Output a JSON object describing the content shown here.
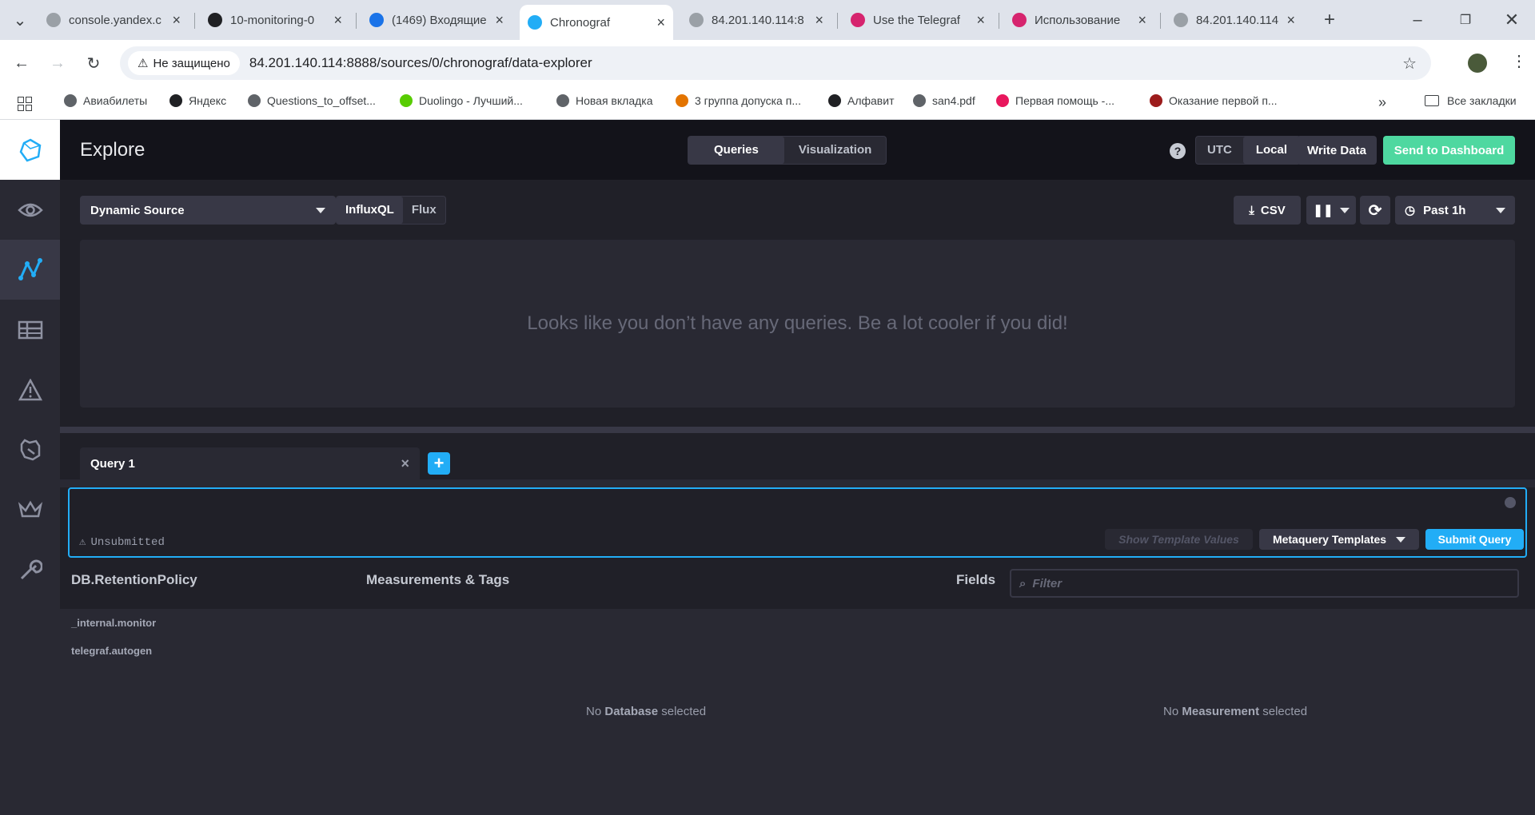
{
  "browser": {
    "tabs": [
      {
        "title": "console.yandex.c",
        "icon": "globe-icon",
        "color": "#9aa0a6"
      },
      {
        "title": "10-monitoring-0",
        "icon": "github-icon",
        "color": "#202124"
      },
      {
        "title": "(1469) Входящие",
        "icon": "mail-icon",
        "color": "#1a73e8"
      },
      {
        "title": "Chronograf",
        "icon": "chronograf-icon",
        "color": "#22adf6",
        "active": true
      },
      {
        "title": "84.201.140.114:8",
        "icon": "globe-icon",
        "color": "#9aa0a6"
      },
      {
        "title": "Use the Telegraf",
        "icon": "influx-icon",
        "color": "#d6246e"
      },
      {
        "title": "Использование",
        "icon": "influx-icon",
        "color": "#d6246e"
      },
      {
        "title": "84.201.140.114",
        "icon": "globe-icon",
        "color": "#9aa0a6"
      }
    ],
    "security": "Не защищено",
    "url": "84.201.140.114:8888/sources/0/chronograf/data-explorer",
    "bookmarks": [
      {
        "label": "Авиабилеты",
        "color": "#5f6368"
      },
      {
        "label": "Яндекс",
        "color": "#202124"
      },
      {
        "label": "Questions_to_offset...",
        "color": "#5f6368"
      },
      {
        "label": "Duolingo - Лучший...",
        "color": "#58cc02"
      },
      {
        "label": "Новая вкладка",
        "color": "#5f6368"
      },
      {
        "label": "3 группа допуска п...",
        "color": "#e37400"
      },
      {
        "label": "Алфавит",
        "color": "#202124"
      },
      {
        "label": "san4.pdf",
        "color": "#5f6368"
      },
      {
        "label": "Первая помощь -...",
        "color": "#e8175d"
      },
      {
        "label": "Оказание первой п...",
        "color": "#9c1c1c"
      }
    ],
    "all_bookmarks": "Все закладки"
  },
  "header": {
    "title": "Explore",
    "view_tabs": [
      "Queries",
      "Visualization"
    ],
    "tz": [
      "UTC",
      "Local"
    ],
    "write_data": "Write Data",
    "send_dashboard": "Send to Dashboard",
    "help": "?"
  },
  "toolbar": {
    "source": "Dynamic Source",
    "lang": [
      "InfluxQL",
      "Flux"
    ],
    "csv": "CSV",
    "time_range": "Past 1h"
  },
  "graph": {
    "empty": "Looks like you don’t have any queries. Be a lot cooler if you did!"
  },
  "query": {
    "tab": "Query 1",
    "status": "Unsubmitted",
    "show_template": "Show Template Values",
    "metaquery": "Metaquery Templates",
    "submit": "Submit Query"
  },
  "schema": {
    "db_header": "DB.RetentionPolicy",
    "meas_header": "Measurements & Tags",
    "fields_header": "Fields",
    "filter_placeholder": "Filter",
    "databases": [
      "_internal.monitor",
      "telegraf.autogen"
    ],
    "no_db_1": "No",
    "no_db_2": "Database",
    "no_db_3": "selected",
    "no_meas_1": "No",
    "no_meas_2": "Measurement",
    "no_meas_3": "selected"
  },
  "colors": {
    "accent": "#22adf6",
    "success": "#4ed8a0",
    "sidebar": "#292933"
  }
}
